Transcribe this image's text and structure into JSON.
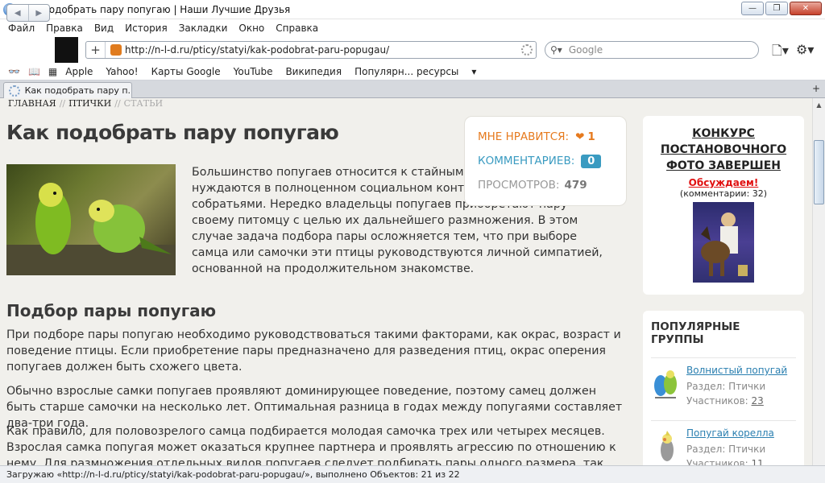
{
  "window": {
    "title": "Как подобрать пару попугаю | Наши Лучшие Друзья"
  },
  "menu": [
    "Файл",
    "Правка",
    "Вид",
    "История",
    "Закладки",
    "Окно",
    "Справка"
  ],
  "toolbar": {
    "url": "http://n-l-d.ru/pticy/statyi/kak-podobrat-paru-popugau/",
    "search_placeholder": "Google"
  },
  "bookmarks": [
    "Apple",
    "Yahoo!",
    "Карты Google",
    "YouTube",
    "Википедия",
    "Популярн... ресурсы"
  ],
  "tab": {
    "label": "Как подобрать пару п..."
  },
  "breadcrumb": {
    "home": "ГЛАВНАЯ",
    "section": "ПТИЧКИ",
    "current": "СТАТЬИ",
    "sep": "//"
  },
  "article": {
    "title": "Как подобрать пару попугаю",
    "intro": "Большинство попугаев относится к стайным видам птиц, которые нуждаются в полноценном социальном контакте со своими собратьями. Нередко владельцы попугаев приобретают пару своему питомцу с целью их дальнейшего размножения. В этом случае задача подбора пары осложняется тем, что при выборе самца или самочки эти птицы руководствуются личной симпатией, основанной на продолжительном знакомстве.",
    "subtitle": "Подбор пары попугаю",
    "p1": "При подборе пары попугаю необходимо руководствоваться такими факторами, как окрас, возраст и поведение птицы. Если приобретение пары предназначено для разведения птиц, окрас оперения попугаев должен быть схожего цвета.",
    "p2": "Обычно взрослые самки попугаев проявляют доминирующее поведение, поэтому самец должен быть старше самочки на несколько лет. Оптимальная разница в годах между попугаями составляет два-три года.",
    "p3": "Как правило, для половозрелого самца подбирается молодая самочка трех или четырех месяцев. Взрослая самка попугая может оказаться крупнее партнера и проявлять агрессию по отношению к нему. Для размножения отдельных видов попугаев следует подбирать пары одного размера, так как такие птицы не"
  },
  "stats": {
    "likes_label": "МНЕ НРАВИТСЯ:",
    "likes": "1",
    "comments_label": "КОММЕНТАРИЕВ:",
    "comments": "0",
    "views_label": "ПРОСМОТРОВ:",
    "views": "479"
  },
  "contest": {
    "title": "КОНКУРС ПОСТАНОВОЧНОГО ФОТО ЗАВЕРШЕН",
    "discuss": "Обсуждаем!",
    "comments": "(комментарии: 32)"
  },
  "groups": {
    "heading": "ПОПУЛЯРНЫЕ ГРУППЫ",
    "items": [
      {
        "name": "Волнистый попугай",
        "section": "Раздел: Птички",
        "members_label": "Участников:",
        "members": "23"
      },
      {
        "name": "Попугай корелла",
        "section": "Раздел: Птички",
        "members_label": "Участников:",
        "members": "11"
      }
    ]
  },
  "status": {
    "text": "Загружаю «http://n-l-d.ru/pticy/statyi/kak-podobrat-paru-popugau/», выполнено Объектов: 21 из 22"
  }
}
